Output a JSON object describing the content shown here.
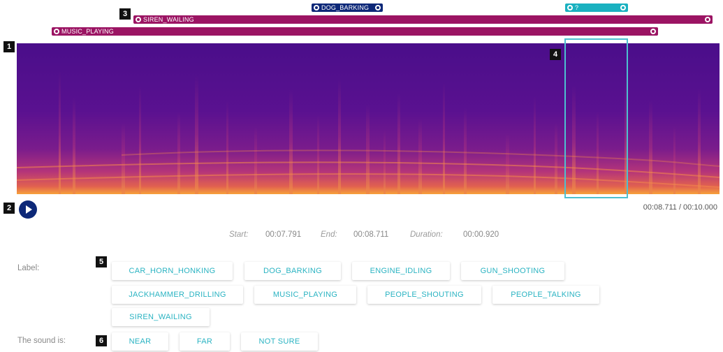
{
  "regions": {
    "dog_barking": "DOG_BARKING",
    "unknown": "?",
    "siren_wailing": "SIREN_WAILING",
    "music_playing": "MUSIC_PLAYING"
  },
  "badges": [
    "1",
    "2",
    "3",
    "4",
    "5",
    "6"
  ],
  "player": {
    "time": "00:08.711 / 00:10.000"
  },
  "selection": {
    "start_label": "Start:",
    "start_value": "00:07.791",
    "end_label": "End:",
    "end_value": "00:08.711",
    "duration_label": "Duration:",
    "duration_value": "00:00.920"
  },
  "label_row": {
    "title": "Label:",
    "options": [
      "CAR_HORN_HONKING",
      "DOG_BARKING",
      "ENGINE_IDLING",
      "GUN_SHOOTING",
      "JACKHAMMER_DRILLING",
      "MUSIC_PLAYING",
      "PEOPLE_SHOUTING",
      "PEOPLE_TALKING",
      "SIREN_WAILING"
    ]
  },
  "proximity_row": {
    "title": "The sound is:",
    "options": [
      "NEAR",
      "FAR",
      "NOT SURE"
    ]
  },
  "colors": {
    "magenta": "#9b1463",
    "navy": "#0d2878",
    "teal": "#1ab1c0",
    "chip_text": "#2ab3c2",
    "spectrogram_base": "#5a1190"
  }
}
